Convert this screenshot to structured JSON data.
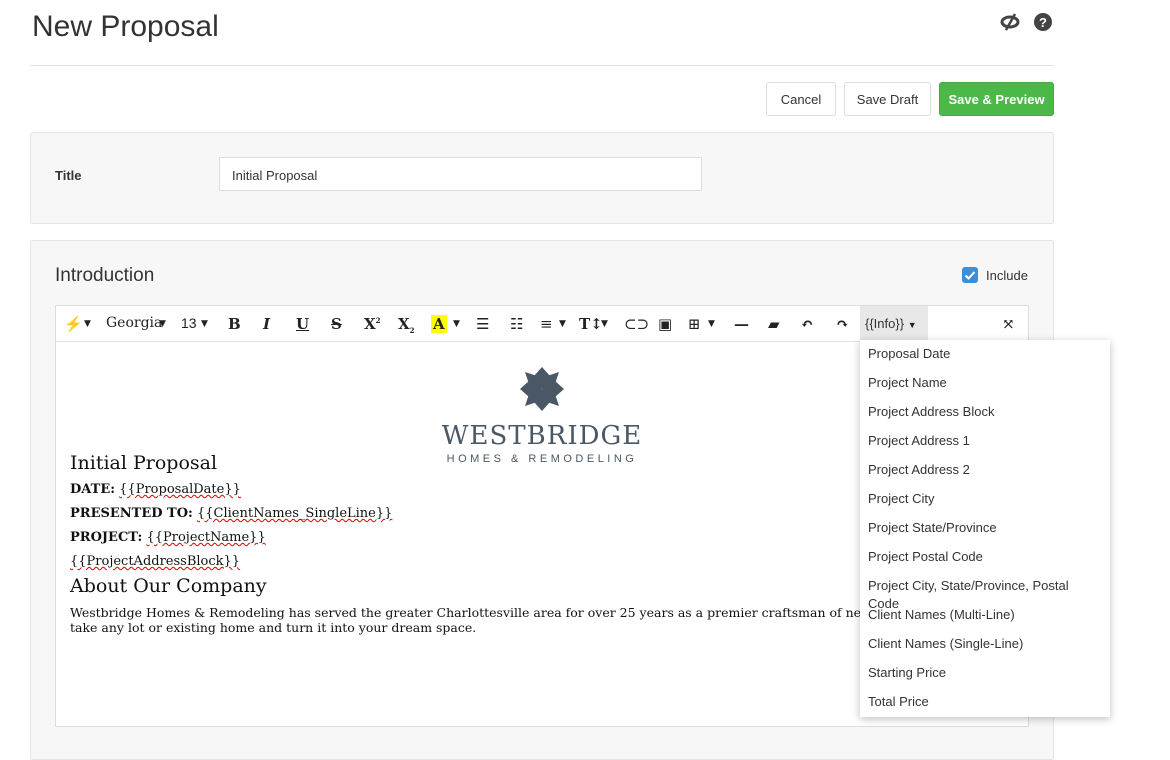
{
  "header": {
    "title": "New Proposal",
    "icons": [
      "eye-slash-icon",
      "help-icon"
    ]
  },
  "actions": {
    "cancel": "Cancel",
    "save_draft": "Save Draft",
    "save_preview": "Save & Preview"
  },
  "title_field": {
    "label": "Title",
    "value": "Initial Proposal"
  },
  "intro": {
    "heading": "Introduction",
    "include_label": "Include",
    "include_checked": true
  },
  "toolbar": {
    "font": "Georgia",
    "size": "13",
    "info": "{{Info}}"
  },
  "doc": {
    "logo_main": "WESTBRIDGE",
    "logo_sub": "HOMES & REMODELING",
    "title": "Initial Proposal",
    "date_label": "DATE:",
    "date_val": "{{ProposalDate}}",
    "to_label": "PRESENTED TO:",
    "to_val": "{{ClientNames_SingleLine}}",
    "project_label": "PROJECT:",
    "project_val": "{{ProjectName}}",
    "address": "{{ProjectAddressBlock}}",
    "about": "About Our Company",
    "para1": "Westbridge Homes & Remodeling has served the greater Charlottesville area for over 25 years as a premier craftsman of new homes and re",
    "para2": "take any lot or existing home and turn it into your dream space."
  },
  "info_menu": [
    "Proposal Date",
    "Project Name",
    "Project Address Block",
    "Project Address 1",
    "Project Address 2",
    "Project City",
    "Project State/Province",
    "Project Postal Code",
    "Project City, State/Province, Postal Code",
    "Client Names (Multi-Line)",
    "Client Names (Single-Line)",
    "Starting Price",
    "Total Price"
  ],
  "colors": {
    "primary": "#4cb848",
    "checkbox": "#3b8ed8",
    "logo": "#4a5866"
  }
}
